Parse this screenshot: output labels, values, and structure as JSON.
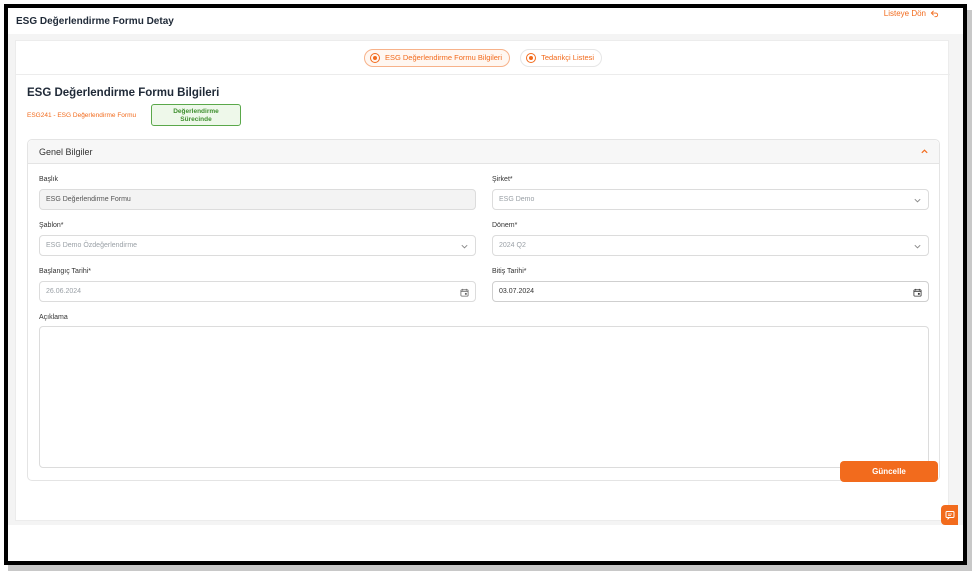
{
  "header": {
    "title": "ESG Değerlendirme Formu Detay",
    "back_label": "Listeye Dön"
  },
  "tabs": [
    {
      "label": "ESG Değerlendirme Formu Bilgileri",
      "active": true
    },
    {
      "label": "Tedarikçi Listesi",
      "active": false
    }
  ],
  "form": {
    "title": "ESG Değerlendirme Formu Bilgileri",
    "code": "ESG241 - ESG Değerlendirme Formu",
    "status_line1": "Değerlendirme",
    "status_line2": "Sürecinde",
    "status_color": "#3f8f2f"
  },
  "panel": {
    "title": "Genel Bilgiler",
    "fields": {
      "title_label": "Başlık",
      "title_value": "ESG Değerlendirme Formu",
      "company_label": "Şirket*",
      "company_value": "ESG Demo",
      "template_label": "Şablon*",
      "template_value": "ESG Demo Özdeğerlendirme",
      "period_label": "Dönem*",
      "period_value": "2024 Q2",
      "start_label": "Başlangıç Tarihi*",
      "start_value": "26.06.2024",
      "end_label": "Bitiş Tarihi*",
      "end_value": "03.07.2024",
      "description_label": "Açıklama",
      "description_value": ""
    }
  },
  "actions": {
    "update_label": "Güncelle",
    "accent_color": "#f26b1d"
  },
  "icons": [
    "back-arrow-icon",
    "radio-dot-icon",
    "chevron-up-icon",
    "chevron-down-icon",
    "calendar-icon",
    "chat-icon"
  ]
}
